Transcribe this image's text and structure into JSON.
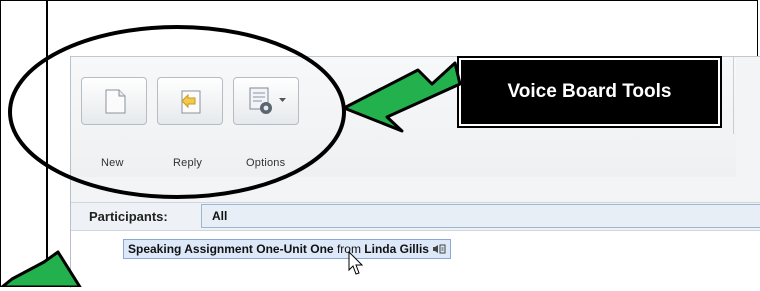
{
  "toolbar": {
    "new_label": "New",
    "reply_label": "Reply",
    "options_label": "Options"
  },
  "participants": {
    "label": "Participants:",
    "value": "All"
  },
  "post": {
    "title": "Speaking Assignment One-Unit One",
    "from_word": "from",
    "author": "Linda Gillis"
  },
  "annotation": {
    "callout_text": "Voice Board Tools"
  },
  "colors": {
    "arrow_green": "#22b14c",
    "annotation_bg": "#000000",
    "selection_bg": "#dde8f8"
  },
  "icons": [
    "new-document-icon",
    "reply-icon",
    "options-icon",
    "dropdown-arrow-icon",
    "audio-icon",
    "mouse-cursor-icon",
    "green-arrow-icon"
  ]
}
